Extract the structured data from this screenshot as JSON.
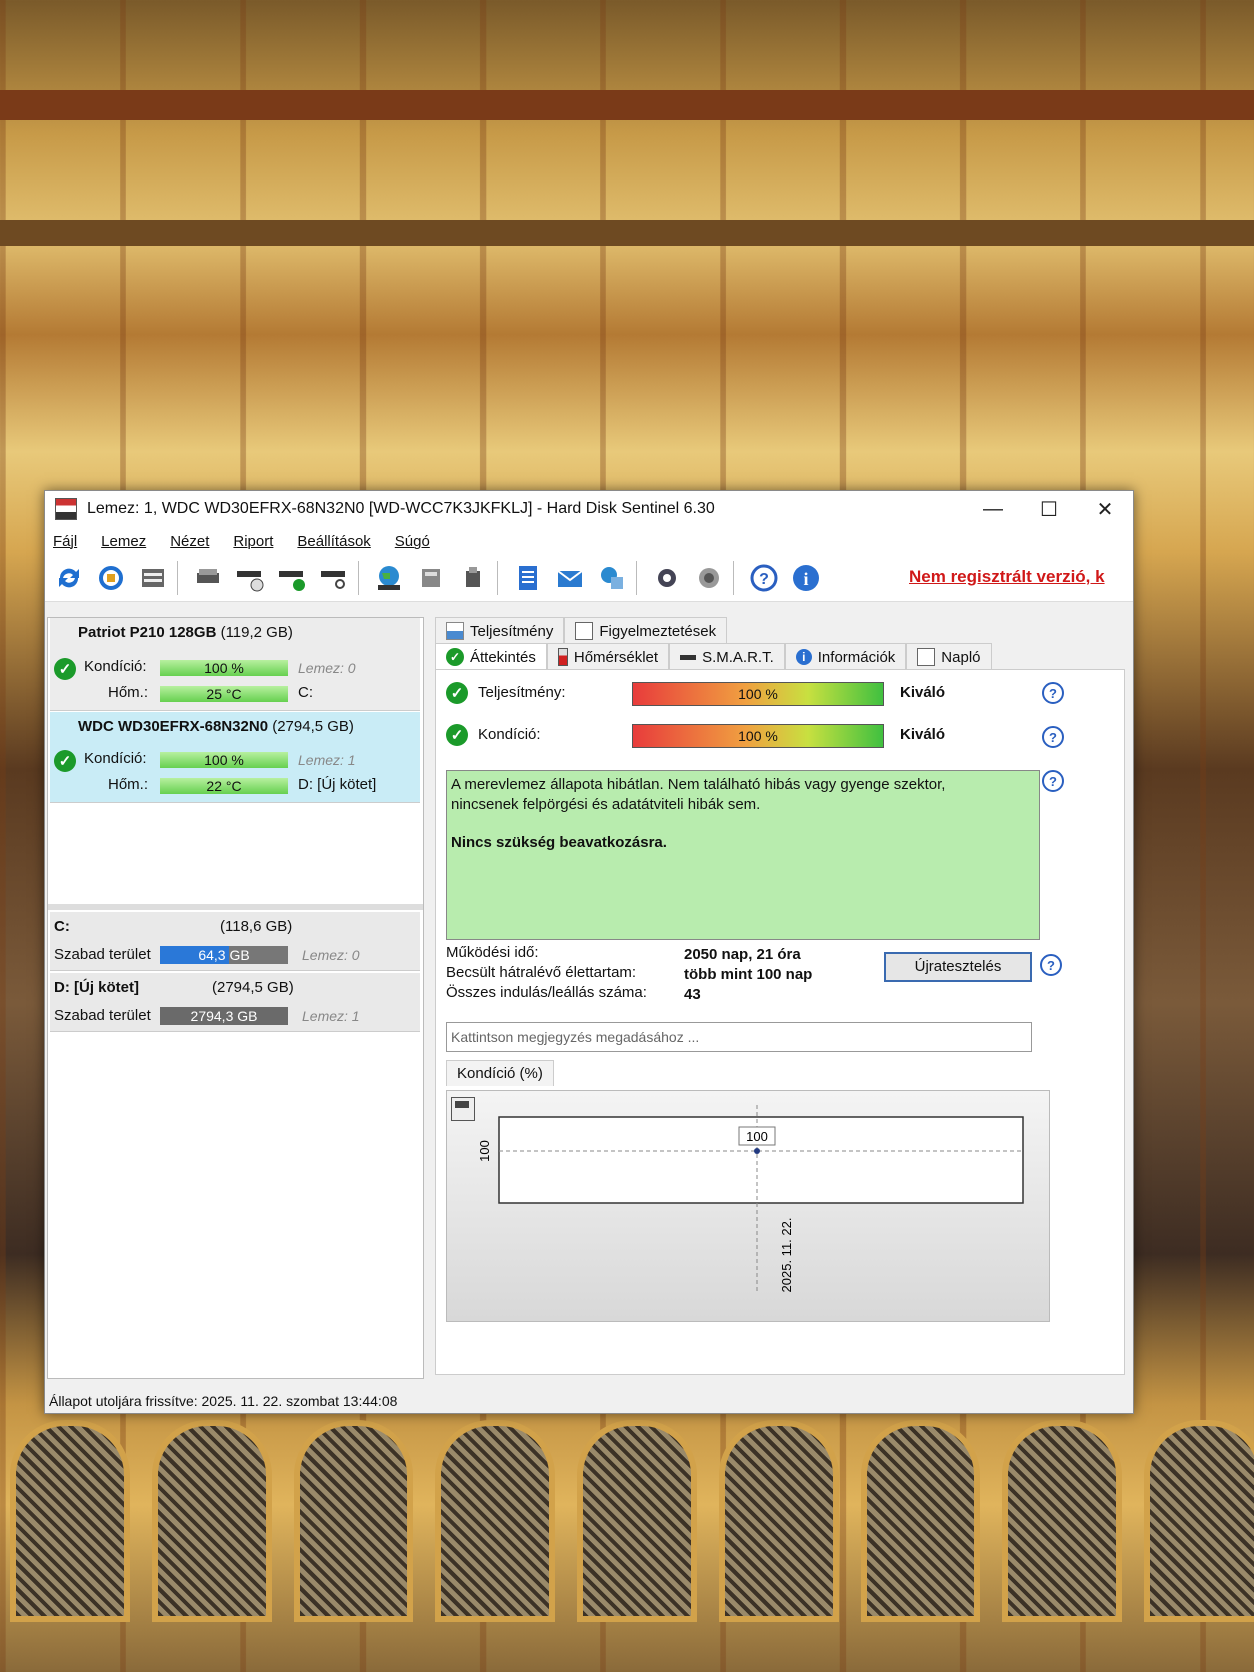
{
  "window": {
    "title": "Lemez: 1, WDC WD30EFRX-68N32N0 [WD-WCC7K3JKFKLJ]  -  Hard Disk Sentinel 6.30",
    "minimize": "—",
    "maximize": "☐",
    "close": "✕"
  },
  "menu": [
    "Fájl",
    "Lemez",
    "Nézet",
    "Riport",
    "Beállítások",
    "Súgó"
  ],
  "toolbar": {
    "unregistered": "Nem regisztrált verzió, k"
  },
  "disks": [
    {
      "name": "Patriot P210 128GB",
      "size": "(119,2 GB)",
      "condition_label": "Kondíció:",
      "condition": "100 %",
      "disk_ref": "Lemez: 0",
      "temp_label": "Hőm.:",
      "temp": "25 °C",
      "drive": "C:"
    },
    {
      "name": "WDC WD30EFRX-68N32N0",
      "size": "(2794,5 GB)",
      "condition_label": "Kondíció:",
      "condition": "100 %",
      "disk_ref": "Lemez: 1",
      "temp_label": "Hőm.:",
      "temp": "22 °C",
      "drive": "D: [Új kötet]"
    }
  ],
  "volumes": [
    {
      "name": "C:",
      "size": "(118,6 GB)",
      "free_label": "Szabad terület",
      "free": "64,3 GB",
      "free_fraction": 0.54,
      "disk_ref": "Lemez: 0"
    },
    {
      "name": "D: [Új kötet]",
      "size": "(2794,5 GB)",
      "free_label": "Szabad terület",
      "free": "2794,3 GB",
      "free_fraction": 1.0,
      "disk_ref": "Lemez: 1"
    }
  ],
  "status_bar": "Állapot utoljára frissítve: 2025. 11. 22. szombat 13:44:08",
  "tabs_row1": [
    "Teljesítmény",
    "Figyelmeztetések"
  ],
  "tabs_row2": [
    "Áttekintés",
    "Hőmérséklet",
    "S.M.A.R.T.",
    "Információk",
    "Napló"
  ],
  "overview": {
    "performance_label": "Teljesítmény:",
    "performance_value": "100 %",
    "performance_verdict": "Kiváló",
    "condition_label": "Kondíció:",
    "condition_value": "100 %",
    "condition_verdict": "Kiváló",
    "message_line1": "A merevlemez állapota hibátlan. Nem található hibás vagy gyenge szektor,",
    "message_line2": "nincsenek felpörgési és adatátviteli hibák sem.",
    "message_bold": "Nincs szükség beavatkozásra.",
    "uptime_label": "Működési idő:",
    "uptime_value": "2050 nap, 21 óra",
    "remaining_label": "Becsült hátralévő élettartam:",
    "remaining_value": "több mint 100 nap",
    "starts_label": "Összes indulás/leállás száma:",
    "starts_value": "43",
    "retest_button": "Újratesztelés",
    "note_placeholder": "Kattintson megjegyzés megadásához ...",
    "chart_tab": "Kondíció  (%)"
  },
  "chart_data": {
    "type": "line",
    "x": [
      "2025. 11. 22."
    ],
    "values": [
      100
    ],
    "ylabel": "100",
    "point_label": "100"
  }
}
